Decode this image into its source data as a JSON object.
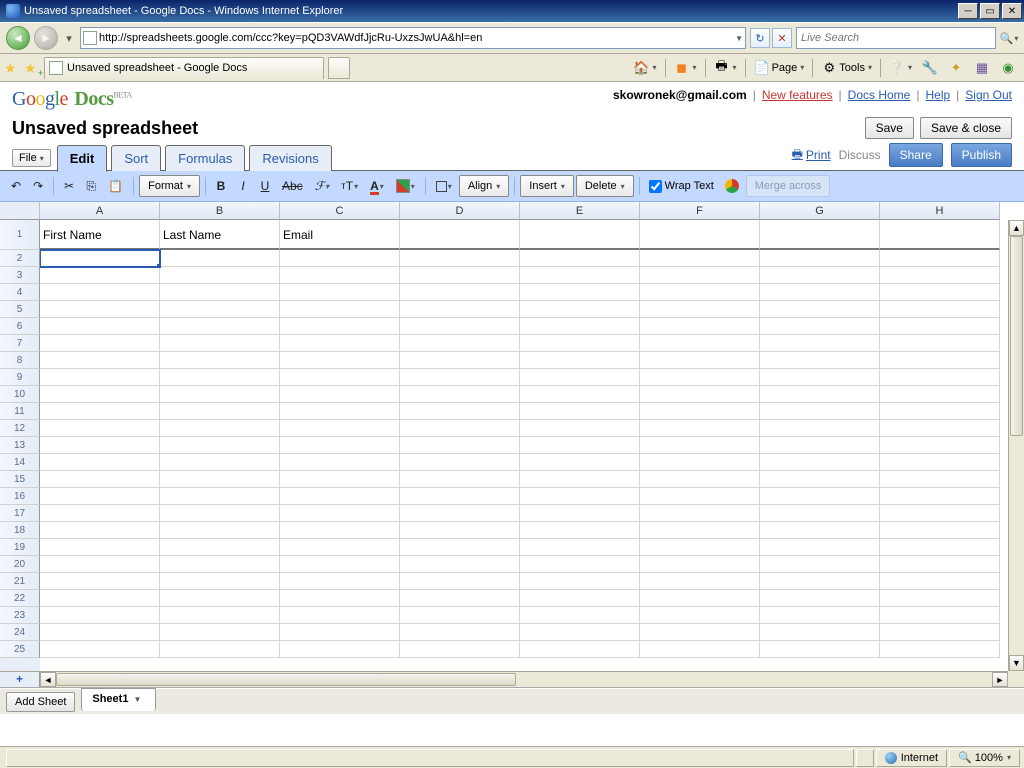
{
  "browser": {
    "title": "Unsaved spreadsheet - Google Docs - Windows Internet Explorer",
    "url": "http://spreadsheets.google.com/ccc?key=pQD3VAWdfJjcRu-UxzsJwUA&hl=en",
    "search_placeholder": "Live Search",
    "tab_title": "Unsaved spreadsheet - Google Docs",
    "tools": {
      "page": "Page",
      "tools": "Tools"
    },
    "status": {
      "zone": "Internet",
      "zoom": "100%"
    }
  },
  "header": {
    "docs_word": "Docs",
    "beta": "BETA",
    "user_email": "skowronek@gmail.com",
    "links": {
      "new_features": "New features",
      "docs_home": "Docs Home",
      "help": "Help",
      "sign_out": "Sign Out"
    },
    "doc_title": "Unsaved spreadsheet",
    "save": "Save",
    "save_close": "Save & close"
  },
  "tabs": {
    "file": "File",
    "edit": "Edit",
    "sort": "Sort",
    "formulas": "Formulas",
    "revisions": "Revisions",
    "print": "Print",
    "discuss": "Discuss",
    "share": "Share",
    "publish": "Publish"
  },
  "toolbar": {
    "format": "Format",
    "align": "Align",
    "insert": "Insert",
    "delete": "Delete",
    "wrap": "Wrap Text",
    "merge": "Merge across"
  },
  "sheet": {
    "columns": [
      "A",
      "B",
      "C",
      "D",
      "E",
      "F",
      "G",
      "H"
    ],
    "row_count": 25,
    "header_cells": [
      "First Name",
      "Last Name",
      "Email",
      "",
      "",
      "",
      "",
      ""
    ],
    "active_cell": "A2",
    "add_sheet": "Add Sheet",
    "tab_name": "Sheet1"
  }
}
